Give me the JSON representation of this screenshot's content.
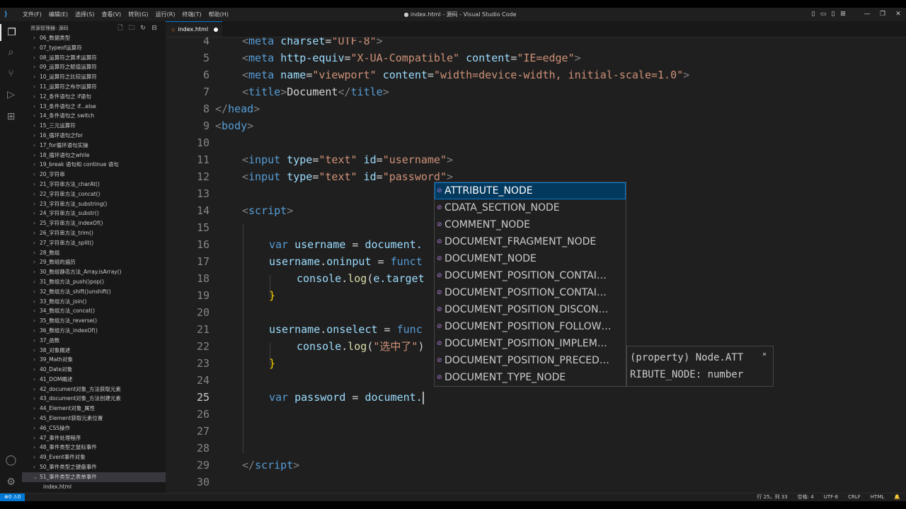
{
  "titlebar": {
    "menu": [
      "文件(F)",
      "编辑(E)",
      "选择(S)",
      "查看(V)",
      "转到(G)",
      "运行(R)",
      "终端(T)",
      "帮助(H)"
    ],
    "title": "● index.html - 源码 - Visual Studio Code"
  },
  "sidebar": {
    "header": "资源管理器: 源码",
    "items": [
      "06_数据类型",
      "07_typeof运算符",
      "08_运算符之算术运算符",
      "09_运算符之赋值运算符",
      "10_运算符之比较运算符",
      "11_运算符之布尔运算符",
      "12_条件语句之 if语句",
      "13_条件语句之 if...else",
      "14_条件语句之 switch",
      "15_三元运算符",
      "16_循环语句之for",
      "17_for循环语句实操",
      "18_循环语句之while",
      "19_break 语句和 continue 语句",
      "20_字符串",
      "21_字符串方法_charAt()",
      "22_字符串方法_concat()",
      "23_字符串方法_substring()",
      "24_字符串方法_substr()",
      "25_字符串方法_indexOf()",
      "26_字符串方法_trim()",
      "27_字符串方法_split()",
      "28_数组",
      "29_数组的遍历",
      "30_数组静态方法_Array.isArray()",
      "31_数组方法_push()pop()",
      "32_数组方法_shift()unshift()",
      "33_数组方法_join()",
      "34_数组方法_concat()",
      "35_数组方法_reverse()",
      "36_数组方法_indexOf()",
      "37_函数",
      "38_对象概述",
      "39_Math对象",
      "40_Date对象",
      "41_DOM概述",
      "42_document对象_方法获取元素",
      "43_document对象_方法创建元素",
      "44_Element对象_属性",
      "45_Element获取元素位置",
      "46_CSS操作",
      "47_事件处理程序",
      "48_事件类型之鼠标事件",
      "49_Event事件对象",
      "50_事件类型之键盘事件",
      "51_事件类型之表单事件"
    ],
    "open_file": "index.html"
  },
  "tab": {
    "label": "index.html"
  },
  "editor": {
    "line_numbers": [
      "4",
      "5",
      "6",
      "7",
      "8",
      "9",
      "10",
      "11",
      "12",
      "13",
      "14",
      "15",
      "16",
      "17",
      "18",
      "19",
      "20",
      "21",
      "22",
      "23",
      "24",
      "25",
      "26",
      "27",
      "28",
      "29",
      "30"
    ],
    "current_line": "25",
    "tokens": {
      "meta": "meta",
      "charset": "charset",
      "utf8": "\"UTF-8\"",
      "http_equiv": "http-equiv",
      "xua": "\"X-UA-Compatible\"",
      "content": "content",
      "ieedge": "\"IE=edge\"",
      "name": "name",
      "viewport": "\"viewport\"",
      "vpval": "\"width=device-width, initial-scale=1.0\"",
      "title": "title",
      "doc": "Document",
      "head": "head",
      "body": "body",
      "input": "input",
      "type": "type",
      "text": "\"text\"",
      "id": "id",
      "uname": "\"username\"",
      "pwd": "\"password\"",
      "script": "script",
      "var": "var",
      "username": "username",
      "document_dot": "document.",
      "eq": " = ",
      "oninput": "oninput",
      "funct": "funct",
      "func": "func",
      "console": "console",
      "log": "log",
      "etarget": "e.target",
      "onselect": "onselect",
      "selected_str": "\"选中了\"",
      "password": "password",
      "rbrace": "}"
    }
  },
  "suggest": {
    "items": [
      "ATTRIBUTE_NODE",
      "CDATA_SECTION_NODE",
      "COMMENT_NODE",
      "DOCUMENT_FRAGMENT_NODE",
      "DOCUMENT_NODE",
      "DOCUMENT_POSITION_CONTAI…",
      "DOCUMENT_POSITION_CONTAI…",
      "DOCUMENT_POSITION_DISCON…",
      "DOCUMENT_POSITION_FOLLOW…",
      "DOCUMENT_POSITION_IMPLEM…",
      "DOCUMENT_POSITION_PRECED…",
      "DOCUMENT_TYPE_NODE"
    ],
    "details_line1": "(property) Node.ATT",
    "details_line2": "RIBUTE_NODE: number"
  },
  "statusbar": {
    "problems": "⊗0 ⚠0",
    "position": "行 25，列 33",
    "spaces": "空格: 4",
    "encoding": "UTF-8",
    "eol": "CRLF",
    "language": "HTML"
  },
  "colors": {
    "accent": "#0078d4",
    "editor_bg": "#1f1f1f",
    "suggest_selected": "#04395e"
  }
}
